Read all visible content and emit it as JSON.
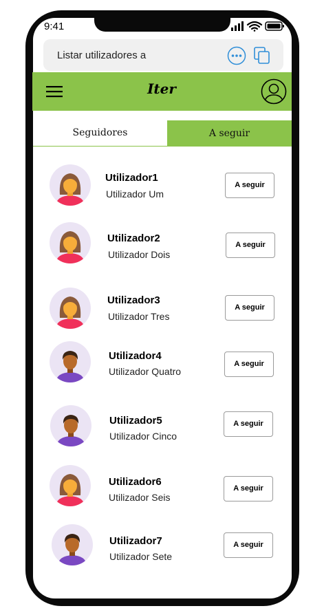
{
  "status": {
    "time": "9:41"
  },
  "browser": {
    "url_text": "Listar utilizadores a"
  },
  "app": {
    "title": "Iter",
    "accent": "#8bc34a"
  },
  "icons": {
    "menu": "hamburger-menu-icon",
    "profile": "user-profile-icon",
    "more": "more-options-icon",
    "copy": "copy-tabs-icon",
    "avatar_female": "female-avatar-icon",
    "avatar_male": "male-avatar-icon"
  },
  "tabs": [
    {
      "label": "Seguidores",
      "active": false
    },
    {
      "label": "A seguir",
      "active": true
    }
  ],
  "users": [
    {
      "username": "Utilizador1",
      "name": "Utilizador Um",
      "avatar": "female",
      "button": "A seguir"
    },
    {
      "username": "Utilizador2",
      "name": "Utilizador Dois",
      "avatar": "female",
      "button": "A seguir"
    },
    {
      "username": "Utilizador3",
      "name": "Utilizador Tres",
      "avatar": "female",
      "button": "A seguir"
    },
    {
      "username": "Utilizador4",
      "name": "Utilizador Quatro",
      "avatar": "male",
      "button": "A seguir"
    },
    {
      "username": "Utilizador5",
      "name": "Utilizador Cinco",
      "avatar": "male",
      "button": "A seguir"
    },
    {
      "username": "Utilizador6",
      "name": "Utilizador Seis",
      "avatar": "female",
      "button": "A seguir"
    },
    {
      "username": "Utilizador7",
      "name": "Utilizador Sete",
      "avatar": "male",
      "button": "A seguir"
    }
  ]
}
